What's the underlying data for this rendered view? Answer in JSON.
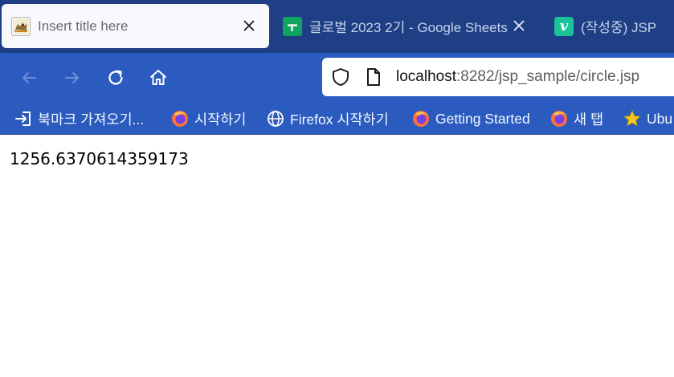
{
  "tabs": [
    {
      "title": "Insert title here",
      "icon": "tomcat-icon",
      "active": true
    },
    {
      "title": "글로벌 2023 2기 - Google Sheets",
      "icon": "google-sheets-icon",
      "active": false
    },
    {
      "title": "(작성중) JSP",
      "icon": "velog-icon",
      "active": false
    }
  ],
  "navigation": {
    "url_host": "localhost",
    "url_path": ":8282/jsp_sample/circle.jsp"
  },
  "bookmarks": [
    {
      "label": "북마크 가져오기...",
      "icon": "import-icon"
    },
    {
      "label": "시작하기",
      "icon": "firefox-icon"
    },
    {
      "label": "Firefox 시작하기",
      "icon": "globe-icon"
    },
    {
      "label": "Getting Started",
      "icon": "firefox-icon"
    },
    {
      "label": "새 탭",
      "icon": "firefox-icon"
    },
    {
      "label": "Ubu",
      "icon": "star-icon"
    }
  ],
  "page": {
    "output": "1256.6370614359173"
  },
  "colors": {
    "tabstrip": "#1e3f86",
    "toolbar": "#2b5bbf",
    "active_tab": "#f7f9fd"
  }
}
